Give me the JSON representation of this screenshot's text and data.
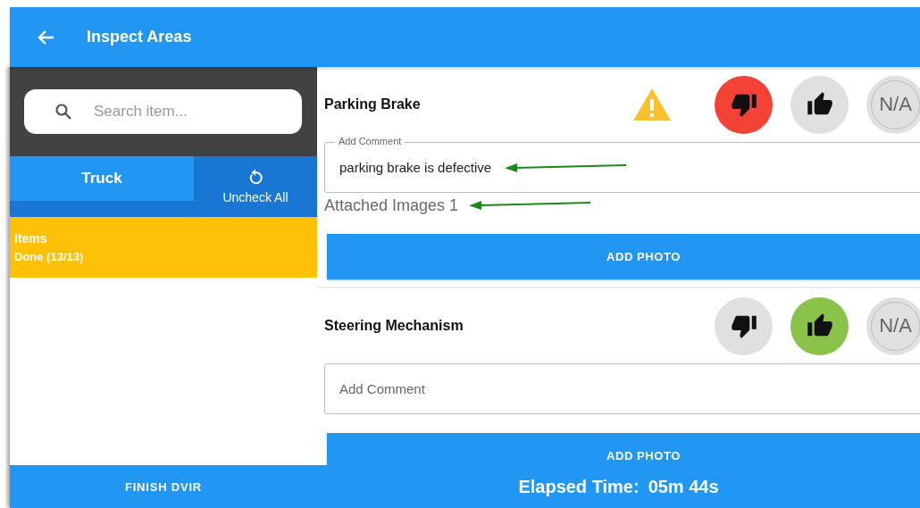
{
  "header": {
    "title": "Inspect Areas"
  },
  "sidebar": {
    "search": {
      "placeholder": "Search item..."
    },
    "tabs": [
      {
        "label": "Truck",
        "selected": true
      }
    ],
    "uncheck_all": "Uncheck All",
    "groups": [
      {
        "title": "Items",
        "status": "Done (13/13)",
        "selected": true
      }
    ],
    "finish_button": "FINISH DVIR"
  },
  "items": [
    {
      "title": "Parking Brake",
      "warning": true,
      "comment": {
        "label": "Add Comment",
        "value": "parking brake is defective"
      },
      "attached_images": "Attached Images 1",
      "add_photo": "ADD PHOTO",
      "ratings": [
        {
          "kind": "fail",
          "selected": true
        },
        {
          "kind": "pass",
          "selected": false
        },
        {
          "kind": "na",
          "label": "N/A",
          "selected": false
        }
      ]
    },
    {
      "title": "Steering Mechanism",
      "warning": false,
      "comment": {
        "placeholder": "Add Comment"
      },
      "add_photo": "ADD PHOTO",
      "ratings": [
        {
          "kind": "fail",
          "selected": false
        },
        {
          "kind": "pass",
          "selected": true
        },
        {
          "kind": "na",
          "label": "N/A",
          "selected": false
        }
      ]
    }
  ],
  "elapsed": {
    "label": "Elapsed Time:",
    "value": "05m 44s"
  }
}
